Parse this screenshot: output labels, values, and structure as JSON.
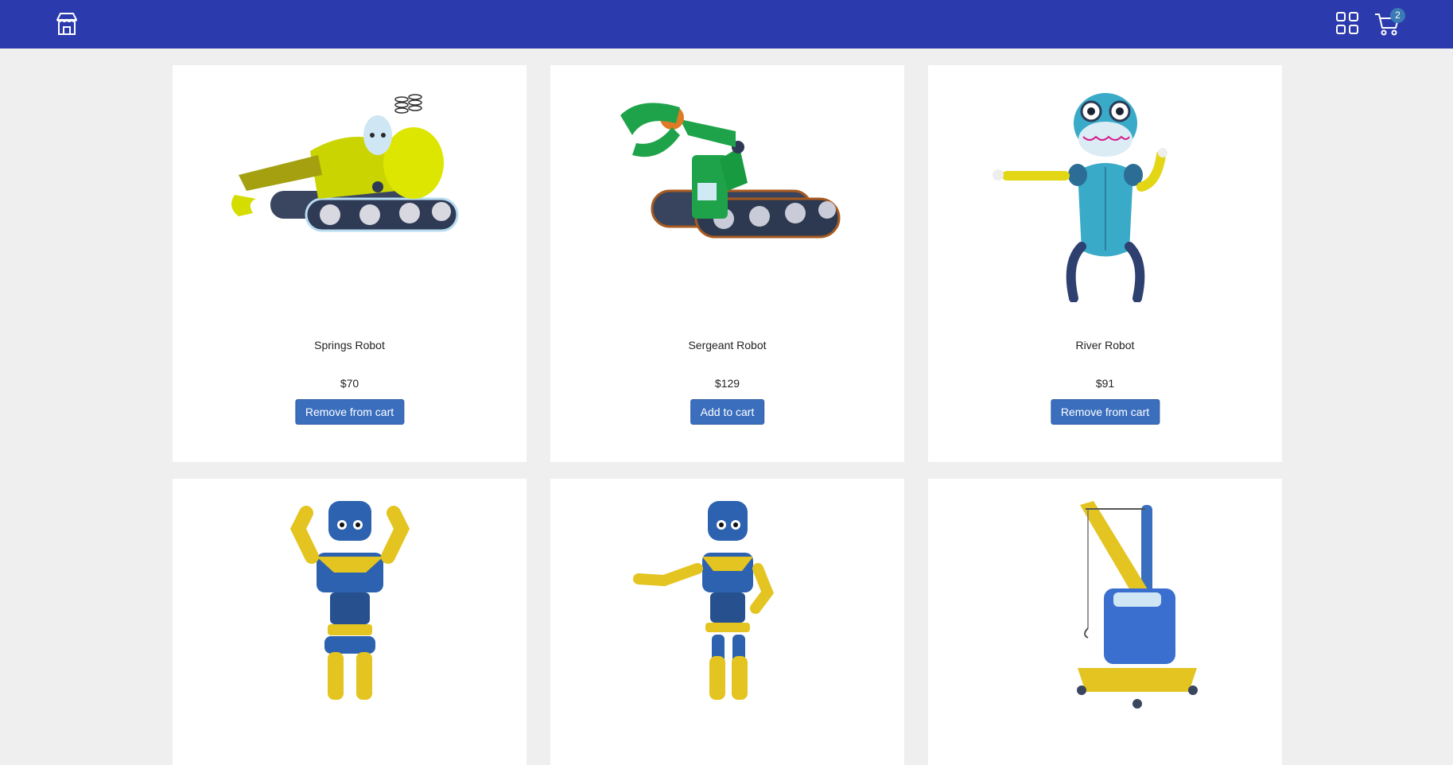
{
  "header": {
    "cart_count": "2",
    "icons": [
      "store-icon",
      "grid-icon",
      "shopping-cart-icon"
    ],
    "background_color": "#2b3aad"
  },
  "products": [
    {
      "name": "Springs Robot",
      "price": "$70",
      "button_label": "Remove from cart",
      "in_cart": true
    },
    {
      "name": "Sergeant Robot",
      "price": "$129",
      "button_label": "Add to cart",
      "in_cart": false
    },
    {
      "name": "River Robot",
      "price": "$91",
      "button_label": "Remove from cart",
      "in_cart": true
    },
    {
      "name": "",
      "price": "",
      "button_label": ""
    },
    {
      "name": "",
      "price": "",
      "button_label": ""
    },
    {
      "name": "",
      "price": "",
      "button_label": ""
    }
  ],
  "colors": {
    "button": "#3b6fbe",
    "badge": "#3a7ab5"
  }
}
